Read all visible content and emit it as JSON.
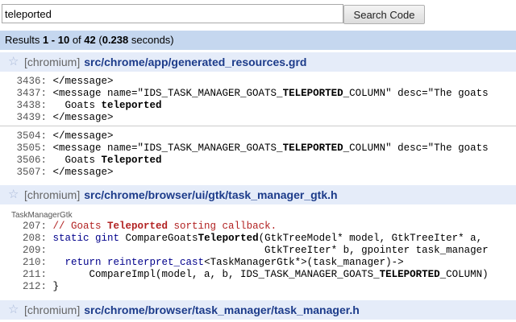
{
  "search": {
    "value": "teleported",
    "button_label": "Search Code"
  },
  "results": {
    "prefix": "Results ",
    "range": "1 - 10",
    "of": " of ",
    "total": "42",
    "time_open": " (",
    "time": "0.238",
    "time_close": " seconds)"
  },
  "files": [
    {
      "project": "[chromium]",
      "path": "src/chrome/app/generated_resources.grd",
      "blocks": [
        [
          {
            "n": "3436:",
            "parts": [
              {
                "t": "</message>"
              }
            ]
          },
          {
            "n": "3437:",
            "parts": [
              {
                "t": "<message name=\"IDS_TASK_MANAGER_GOATS_"
              },
              {
                "t": "TELEPORTED",
                "c": "hl"
              },
              {
                "t": "_COLUMN\" desc=\"The goats"
              }
            ]
          },
          {
            "n": "3438:",
            "parts": [
              {
                "t": "  Goats "
              },
              {
                "t": "teleported",
                "c": "hl"
              }
            ]
          },
          {
            "n": "3439:",
            "parts": [
              {
                "t": "</message>"
              }
            ]
          }
        ],
        [
          {
            "n": "3504:",
            "parts": [
              {
                "t": "</message>"
              }
            ]
          },
          {
            "n": "3505:",
            "parts": [
              {
                "t": "<message name=\"IDS_TASK_MANAGER_GOATS_"
              },
              {
                "t": "TELEPORTED",
                "c": "hl"
              },
              {
                "t": "_COLUMN\" desc=\"The goats"
              }
            ]
          },
          {
            "n": "3506:",
            "parts": [
              {
                "t": "  Goats "
              },
              {
                "t": "Teleported",
                "c": "hl"
              }
            ]
          },
          {
            "n": "3507:",
            "parts": [
              {
                "t": "</message>"
              }
            ]
          }
        ]
      ]
    },
    {
      "project": "[chromium]",
      "path": "src/chrome/browser/ui/gtk/task_manager_gtk.h",
      "context": "TaskManagerGtk",
      "blocks": [
        [
          {
            "n": "207:",
            "parts": [
              {
                "t": "// Goats ",
                "c": "cm"
              },
              {
                "t": "Teleported",
                "c": "cm hl"
              },
              {
                "t": " sorting callback.",
                "c": "cm"
              }
            ]
          },
          {
            "n": "208:",
            "parts": [
              {
                "t": "static gint",
                "c": "kw"
              },
              {
                "t": " CompareGoats"
              },
              {
                "t": "Teleported",
                "c": "hl"
              },
              {
                "t": "(GtkTreeModel* model, GtkTreeIter* a,"
              }
            ]
          },
          {
            "n": "209:",
            "parts": [
              {
                "t": "                                   GtkTreeIter* b, gpointer task_manager"
              }
            ]
          },
          {
            "n": "210:",
            "parts": [
              {
                "t": "  "
              },
              {
                "t": "return reinterpret_cast",
                "c": "kw"
              },
              {
                "t": "<TaskManagerGtk*>(task_manager)->"
              }
            ]
          },
          {
            "n": "211:",
            "parts": [
              {
                "t": "      CompareImpl(model, a, b, IDS_TASK_MANAGER_GOATS_"
              },
              {
                "t": "TELEPORTED",
                "c": "hl"
              },
              {
                "t": "_COLUMN)"
              }
            ]
          },
          {
            "n": "212:",
            "parts": [
              {
                "t": "}"
              }
            ]
          }
        ]
      ]
    },
    {
      "project": "[chromium]",
      "path": "src/chrome/browser/task_manager/task_manager.h",
      "blocks": []
    }
  ]
}
